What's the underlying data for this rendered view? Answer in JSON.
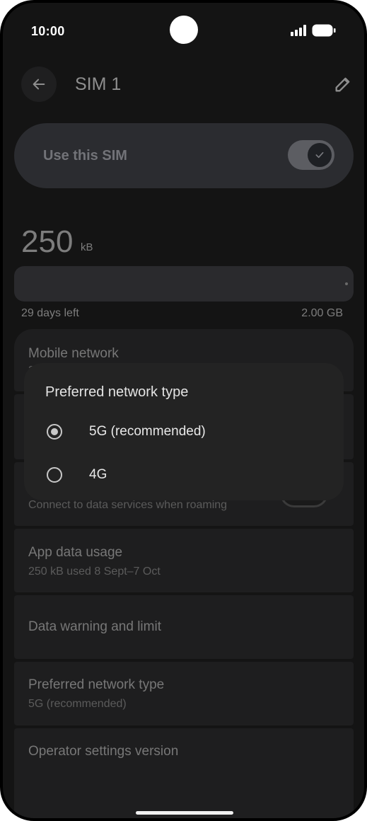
{
  "status_bar": {
    "time": "10:00",
    "signal_icon": "signal-icon",
    "battery_icon": "battery-icon"
  },
  "header": {
    "title": "SIM 1",
    "back_icon": "arrow-left-icon",
    "edit_icon": "pencil-icon"
  },
  "use_sim": {
    "label": "Use this SIM",
    "enabled": true
  },
  "usage": {
    "amount": "250",
    "unit": "kB",
    "days_left": "29 days left",
    "total": "2.00 GB"
  },
  "list": {
    "mobile_network": {
      "title": "Mobile network",
      "subtitle": "3"
    },
    "roaming": {
      "subtitle": "Connect to data services when roaming"
    },
    "app_data_usage": {
      "title": "App data usage",
      "subtitle": "250 kB used 8 Sept–7 Oct"
    },
    "data_warning": {
      "title": "Data warning and limit"
    },
    "preferred_network": {
      "title": "Preferred network type",
      "subtitle": "5G (recommended)"
    },
    "operator_settings": {
      "title": "Operator settings version"
    }
  },
  "dialog": {
    "title": "Preferred network type",
    "options": [
      {
        "label": "5G (recommended)",
        "selected": true
      },
      {
        "label": "4G",
        "selected": false
      }
    ]
  },
  "colors": {
    "background": "#141414",
    "card": "#1e1e1f",
    "dialog": "#232323"
  }
}
